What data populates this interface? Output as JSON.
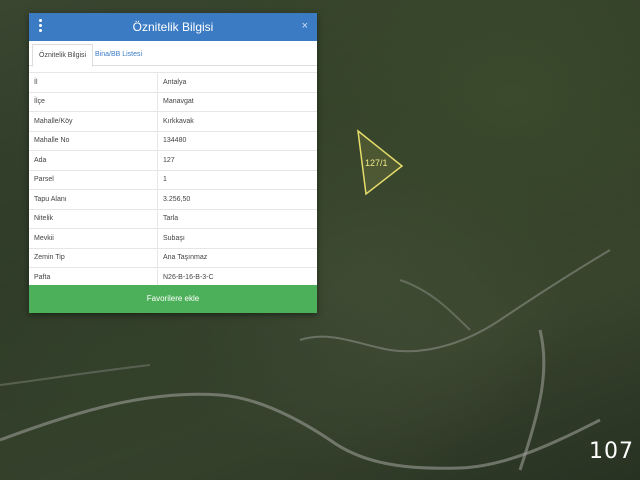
{
  "map": {
    "parcel_label": "127/1",
    "corner_number": "107"
  },
  "panel": {
    "title": "Öznitelik Bilgisi",
    "close_symbol": "×",
    "tabs": [
      "Öznitelik Bilgisi",
      "Bina/BB Listesi"
    ],
    "rows": [
      {
        "key": "İl",
        "value": "Antalya"
      },
      {
        "key": "İlçe",
        "value": "Manavgat"
      },
      {
        "key": "Mahalle/Köy",
        "value": "Kırkkavak"
      },
      {
        "key": "Mahalle No",
        "value": "134480"
      },
      {
        "key": "Ada",
        "value": "127"
      },
      {
        "key": "Parsel",
        "value": "1"
      },
      {
        "key": "Tapu Alanı",
        "value": "3.256,50"
      },
      {
        "key": "Nitelik",
        "value": "Tarla"
      },
      {
        "key": "Mevkii",
        "value": "Subaşı"
      },
      {
        "key": "Zemin Tip",
        "value": "Ana Taşınmaz"
      },
      {
        "key": "Pafta",
        "value": "N26-B-16-B-3-C"
      }
    ],
    "favorite_button": "Favorilere ekle"
  },
  "colors": {
    "header": "#3a7bc4",
    "button": "#4cb05a",
    "parcel_outline": "#e5dc6a"
  }
}
